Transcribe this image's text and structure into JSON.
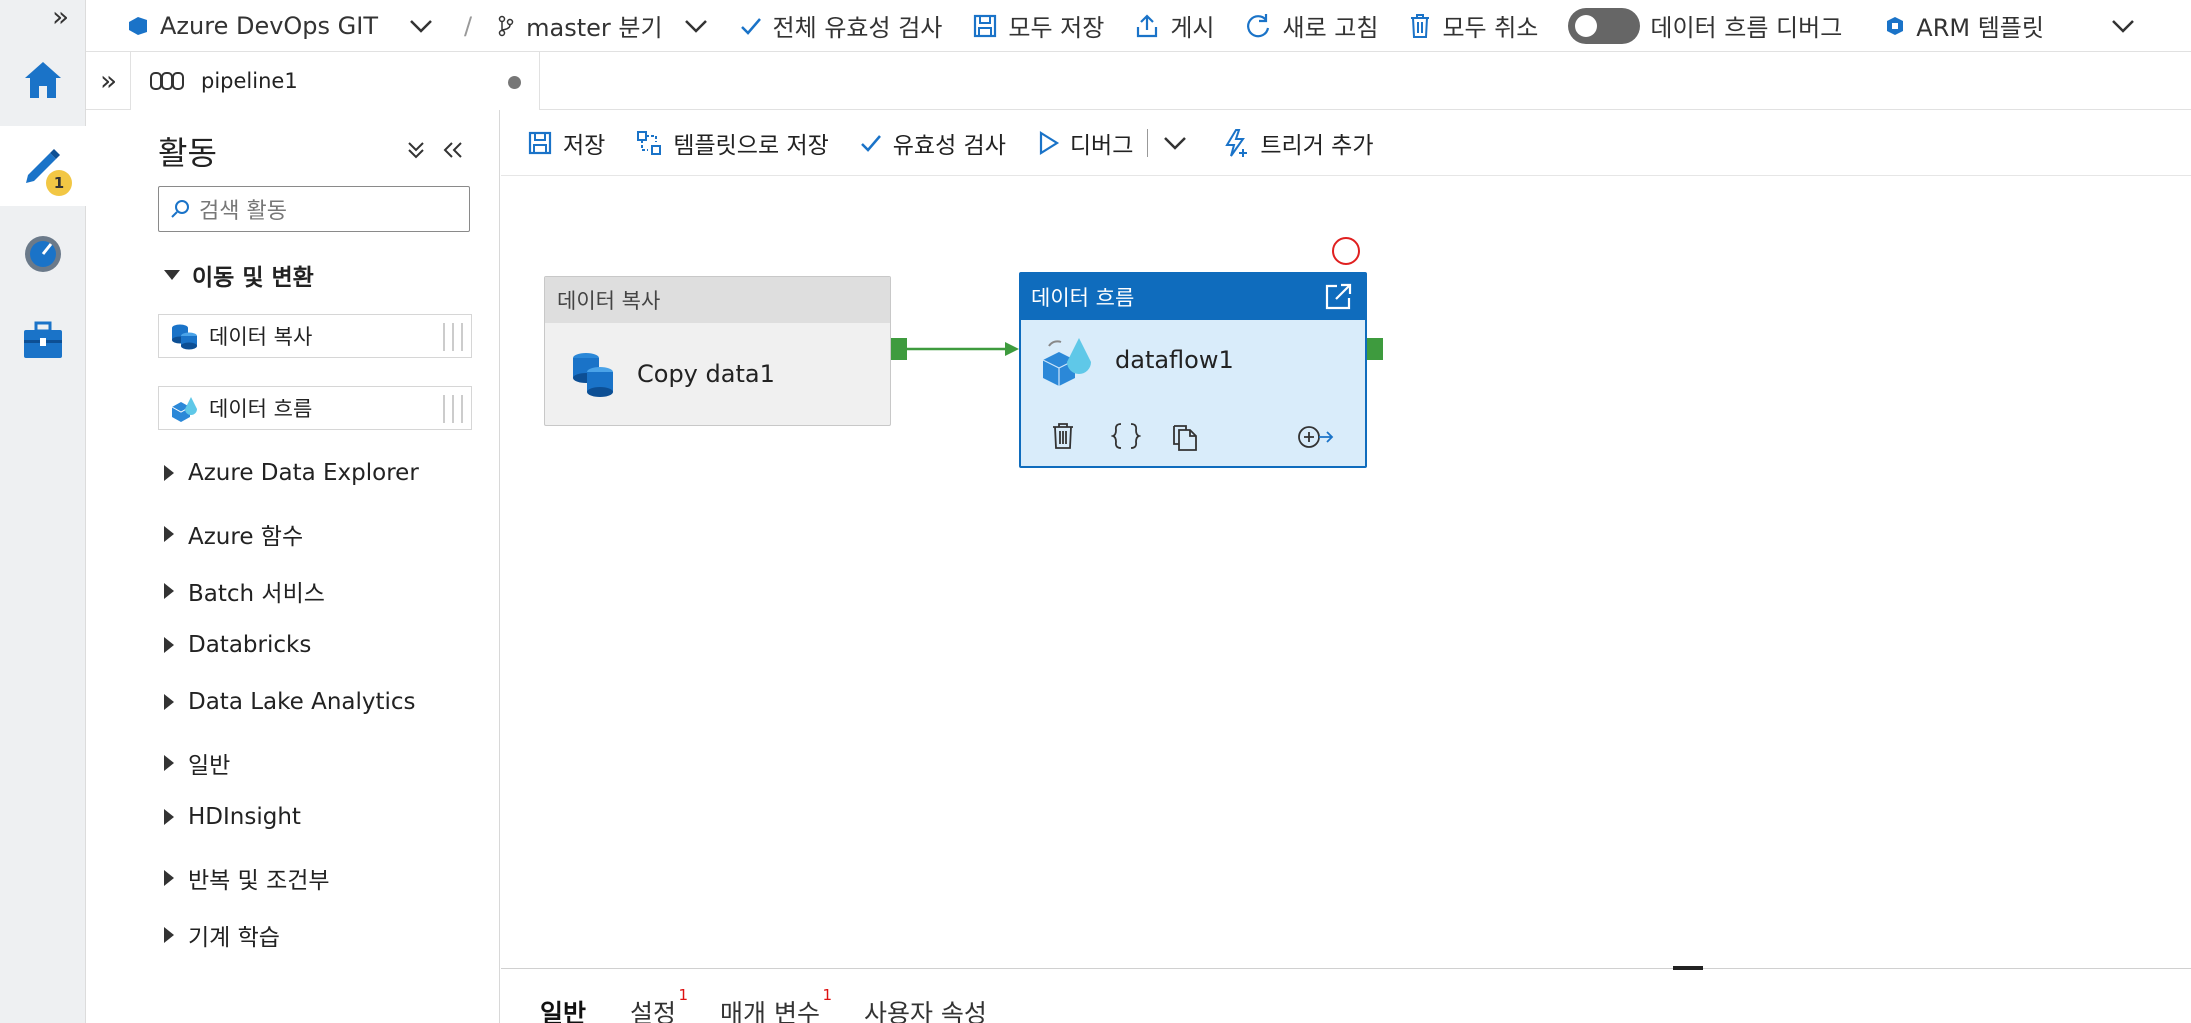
{
  "topbar": {
    "expand_glyph": "»",
    "repo": "Azure DevOps GIT",
    "separator": "/",
    "branch": "master 분기",
    "validate_all": "전체 유효성 검사",
    "save_all": "모두 저장",
    "publish": "게시",
    "refresh": "새로 고침",
    "discard_all": "모두 취소",
    "dataflow_debug": "데이터 흐름 디버그",
    "arm_template": "ARM 템플릿"
  },
  "rail": {
    "author_badge": "1"
  },
  "tabstrip": {
    "collapse_glyph": "»",
    "tab_label": "pipeline1"
  },
  "activities": {
    "title": "활동",
    "search_placeholder": "검색 활동",
    "group": "이동 및 변환",
    "items": [
      {
        "label": "데이터 복사"
      },
      {
        "label": "데이터 흐름"
      }
    ],
    "categories": [
      "Azure Data Explorer",
      "Azure 함수",
      "Batch 서비스",
      "Databricks",
      "Data Lake Analytics",
      "일반",
      "HDInsight",
      "반복 및 조건부",
      "기계 학습"
    ]
  },
  "canvas_toolbar": {
    "save": "저장",
    "save_as_template": "템플릿으로 저장",
    "validate": "유효성 검사",
    "debug": "디버그",
    "add_trigger": "트리거 추가"
  },
  "nodes": {
    "copy": {
      "type": "데이터 복사",
      "name": "Copy data1"
    },
    "flow": {
      "type": "데이터 흐름",
      "name": "dataflow1"
    }
  },
  "bottom_tabs": [
    {
      "label": "일반",
      "badge": ""
    },
    {
      "label": "설정",
      "badge": "1"
    },
    {
      "label": "매개 변수",
      "badge": "1"
    },
    {
      "label": "사용자 속성",
      "badge": ""
    }
  ],
  "colors": {
    "accent": "#0f6cbd",
    "port": "#3e9b3e",
    "badge": "#f2c744",
    "error": "#e02020"
  }
}
